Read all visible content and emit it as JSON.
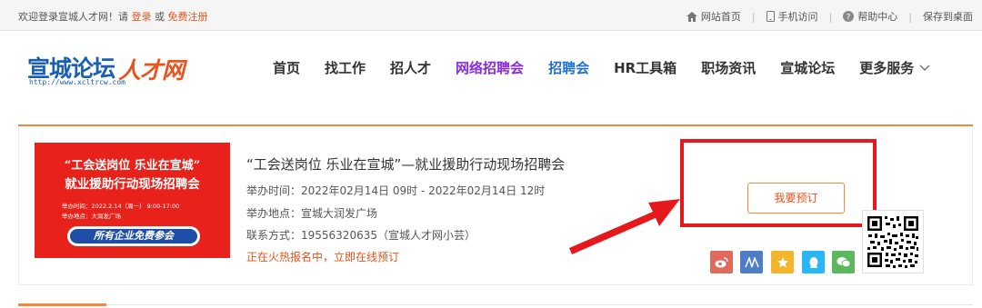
{
  "topbar": {
    "welcome_prefix": "欢迎登录宣城人才网！请",
    "login": "登录",
    "or": "或",
    "register": "免费注册",
    "links": [
      {
        "label": "网站首页",
        "icon": "home-icon"
      },
      {
        "label": "手机访问",
        "icon": "mobile-icon"
      },
      {
        "label": "帮助中心",
        "icon": "help-icon"
      },
      {
        "label": "保存到桌面",
        "icon": ""
      }
    ],
    "separator": "|"
  },
  "logo": {
    "part1": "宣城论坛",
    "part2": "人才网",
    "url": "http://www.xcltrcw.com"
  },
  "nav": {
    "items": [
      "首页",
      "找工作",
      "招人才",
      "网络招聘会",
      "招聘会",
      "HR工具箱",
      "职场资讯",
      "宣城论坛",
      "更多服务"
    ]
  },
  "banner": {
    "line1": "“工会送岗位  乐业在宣城”",
    "line2": "就业援助行动现场招聘会",
    "line3": "举办时间：2022.2.14（周一）  9:00-17:00",
    "line4": "举办地点：大润发广场",
    "pill": "所有企业免费参会"
  },
  "fair": {
    "title": "“工会送岗位 乐业在宣城”—就业援助行动现场招聘会",
    "time": "举办时间：2022年02月14日 09时 - 2022年02月14日 12时",
    "location": "举办地点：宣城大润发广场",
    "contact": "联系方式：19556320635（宣城人才网小芸）",
    "status": "正在火热报名中，立即在线预订",
    "book_label": "我要预订"
  },
  "share": {
    "icons": [
      "weibo-icon",
      "renren-icon",
      "kaixin-icon",
      "qq-icon",
      "wechat-icon"
    ]
  },
  "colors": {
    "accent": "#e8541e",
    "orange_line": "#f08a3c",
    "logo_blue": "#1a5fb4",
    "nav_purple": "#8a2be2",
    "nav_blue": "#1e6fd9",
    "annotation_red": "#e5191b"
  }
}
